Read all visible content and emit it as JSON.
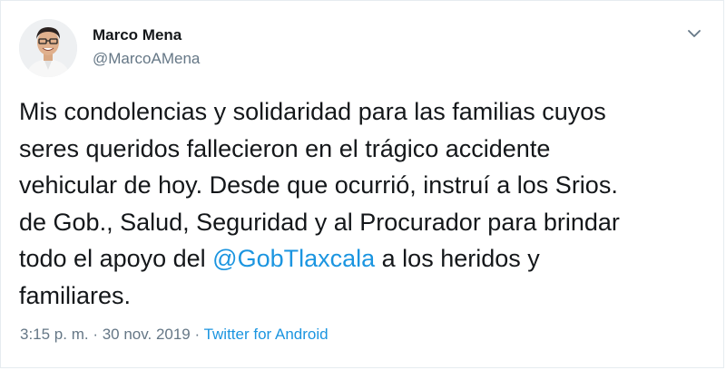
{
  "author": {
    "name": "Marco Mena",
    "handle": "@MarcoAMena"
  },
  "tweet": {
    "text_lines": [
      "Mis condolencias y solidaridad para las familias cuyos",
      "seres queridos fallecieron en el trágico accidente",
      "vehicular de hoy. Desde que ocurrió, instruí a los Srios.",
      "de Gob., Salud, Seguridad y al Procurador para brindar",
      "todo el apoyo del "
    ],
    "mention": "@GobTlaxcala",
    "after_mention": " a los heridos y",
    "last_line": "familiares."
  },
  "meta": {
    "time": "3:15 p. m.",
    "separator": " · ",
    "date": "30 nov. 2019",
    "source": "Twitter for Android"
  },
  "icons": {
    "caret": "chevron-down-icon"
  },
  "colors": {
    "link": "#1b95e0",
    "secondary": "#657786",
    "text": "#14171a"
  }
}
